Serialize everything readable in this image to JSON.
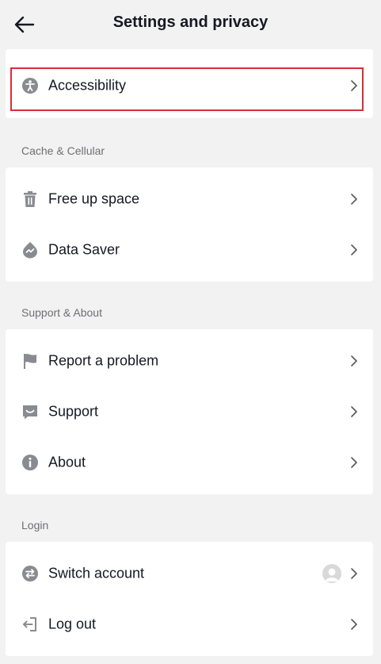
{
  "header": {
    "title": "Settings and privacy"
  },
  "accessibility": {
    "label": "Accessibility",
    "icon": "accessibility-icon"
  },
  "cache": {
    "heading": "Cache & Cellular",
    "items": [
      {
        "label": "Free up space",
        "icon": "trash-icon"
      },
      {
        "label": "Data Saver",
        "icon": "data-saver-icon"
      }
    ]
  },
  "support": {
    "heading": "Support & About",
    "items": [
      {
        "label": "Report a problem",
        "icon": "flag-icon"
      },
      {
        "label": "Support",
        "icon": "chat-icon"
      },
      {
        "label": "About",
        "icon": "info-icon"
      }
    ]
  },
  "login": {
    "heading": "Login",
    "items": [
      {
        "label": "Switch account",
        "icon": "switch-account-icon"
      },
      {
        "label": "Log out",
        "icon": "logout-icon"
      }
    ]
  },
  "colors": {
    "background": "#f2f2f2",
    "card": "#ffffff",
    "icon": "#8a8b91",
    "highlight": "#d62e3a"
  }
}
